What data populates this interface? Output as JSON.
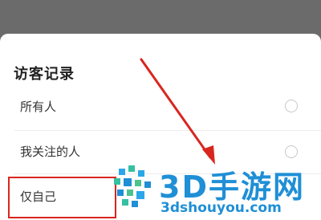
{
  "sheet": {
    "title": "访客记录",
    "options": [
      {
        "label": "所有人",
        "selected": false
      },
      {
        "label": "我关注的人",
        "selected": false
      },
      {
        "label": "仅自己",
        "selected": false
      }
    ]
  },
  "annotation": {
    "highlight_color": "#d8261f",
    "arrow_color": "#d8261f"
  },
  "watermark": {
    "brand": "3D手游网",
    "url": "3dshouyou.com",
    "color": "#1f8fd6"
  }
}
